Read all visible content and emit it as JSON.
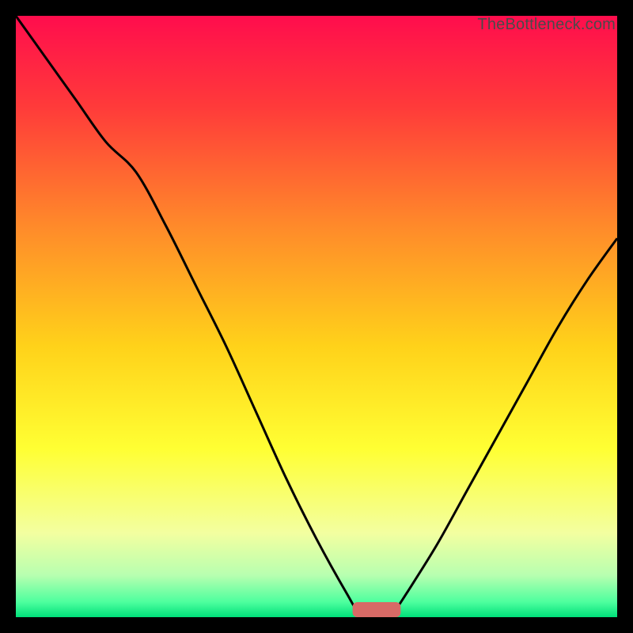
{
  "watermark": "TheBottleneck.com",
  "chart_data": {
    "type": "line",
    "title": "",
    "xlabel": "",
    "ylabel": "",
    "xlim": [
      0,
      100
    ],
    "ylim": [
      0,
      100
    ],
    "x": [
      0,
      5,
      10,
      15,
      20,
      25,
      30,
      35,
      40,
      45,
      50,
      55,
      57,
      60,
      62,
      63,
      65,
      70,
      75,
      80,
      85,
      90,
      95,
      100
    ],
    "y": [
      100,
      93,
      86,
      79,
      74,
      65,
      55,
      45,
      34,
      23,
      13,
      4,
      1,
      0,
      0,
      1,
      4,
      12,
      21,
      30,
      39,
      48,
      56,
      63
    ],
    "gradient_stops": [
      {
        "offset": 0.0,
        "color": "#ff0d4d"
      },
      {
        "offset": 0.15,
        "color": "#ff3a3a"
      },
      {
        "offset": 0.35,
        "color": "#ff8a2a"
      },
      {
        "offset": 0.55,
        "color": "#ffd21a"
      },
      {
        "offset": 0.72,
        "color": "#ffff33"
      },
      {
        "offset": 0.86,
        "color": "#f3ffa0"
      },
      {
        "offset": 0.93,
        "color": "#b8ffb0"
      },
      {
        "offset": 0.975,
        "color": "#4dff9e"
      },
      {
        "offset": 1.0,
        "color": "#00e07a"
      }
    ],
    "marker": {
      "x": 60,
      "y": 0,
      "width": 8,
      "height": 2.5,
      "color": "#d86a66"
    }
  }
}
